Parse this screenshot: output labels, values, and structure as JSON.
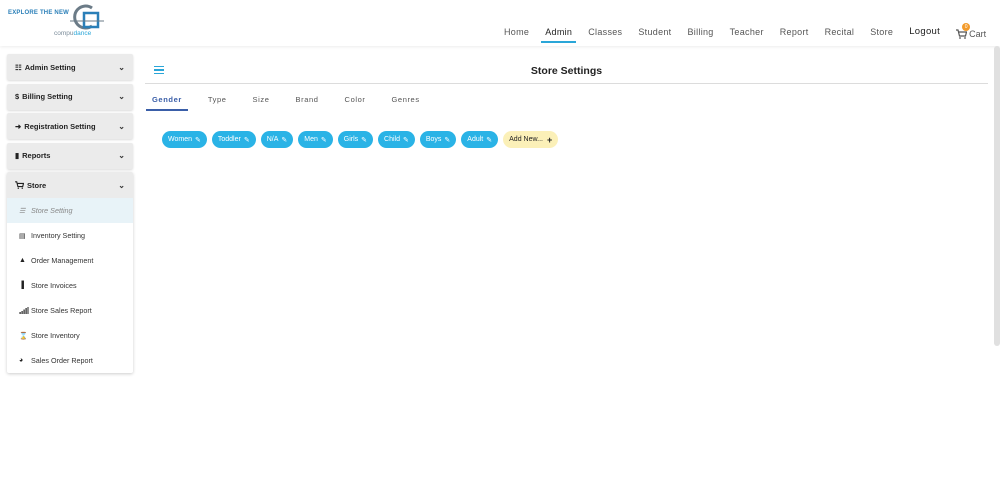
{
  "header": {
    "logo_tagline": "EXPLORE THE NEW",
    "logo_sub_prefix": "compu",
    "logo_sub_accent": "dance",
    "nav": [
      "Home",
      "Admin",
      "Classes",
      "Student",
      "Billing",
      "Teacher",
      "Report",
      "Recital",
      "Store"
    ],
    "active_nav": "Admin",
    "logout_label": "Logout",
    "cart_label": "Cart",
    "cart_count": "0",
    "accent_color": "#2aa6d8"
  },
  "sidebar": {
    "sections": [
      {
        "icon": "list-icon",
        "glyph": "☷",
        "label": "Admin Setting"
      },
      {
        "icon": "dollar-icon",
        "glyph": "$",
        "label": "Billing Setting"
      },
      {
        "icon": "sign-in-icon",
        "glyph": "➜",
        "label": "Registration Setting"
      },
      {
        "icon": "bar-chart-icon",
        "glyph": "▮",
        "label": "Reports"
      }
    ],
    "store": {
      "icon": "cart-icon",
      "label": "Store",
      "items": [
        {
          "icon": "list-ul-icon",
          "glyph": "☰",
          "label": "Store Setting",
          "active": true
        },
        {
          "icon": "warehouse-icon",
          "glyph": "▤",
          "label": "Inventory Setting"
        },
        {
          "icon": "bag-icon",
          "glyph": "▲",
          "label": "Order Management"
        },
        {
          "icon": "file-icon",
          "glyph": "▐",
          "label": "Store Invoices"
        },
        {
          "icon": "signal-icon",
          "glyph": "▁",
          "label": "Store Sales Report"
        },
        {
          "icon": "hourglass-icon",
          "glyph": "⌛",
          "label": "Store Inventory"
        },
        {
          "icon": "pie-chart-icon",
          "glyph": "◕",
          "label": "Sales Order Report"
        }
      ]
    }
  },
  "main": {
    "title": "Store Settings",
    "tabs": [
      "Gender",
      "Type",
      "Size",
      "Brand",
      "Color",
      "Genres"
    ],
    "active_tab": "Gender",
    "chips": [
      "Women",
      "Toddler",
      "N/A",
      "Men",
      "Girls",
      "Child",
      "Boys",
      "Adult"
    ],
    "add_label": "Add New...",
    "chip_color": "#2ab3e6",
    "add_color": "#fbf0b8"
  }
}
